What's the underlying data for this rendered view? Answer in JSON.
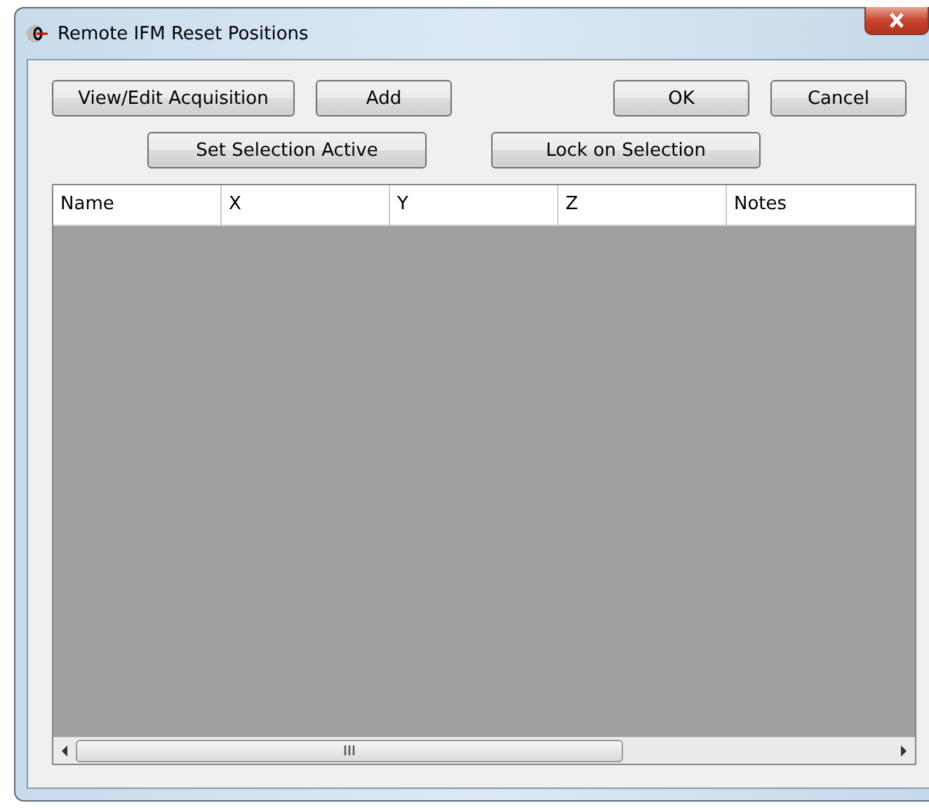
{
  "window": {
    "title": "Remote IFM Reset Positions"
  },
  "buttons_row1_left": [
    "View/Edit Acquisition",
    "Add"
  ],
  "buttons_row1_right": [
    "OK",
    "Cancel"
  ],
  "buttons_row2": [
    "Set Selection Active",
    "Lock on Selection"
  ],
  "table": {
    "columns": [
      "Name",
      "X",
      "Y",
      "Z",
      "Notes"
    ]
  }
}
